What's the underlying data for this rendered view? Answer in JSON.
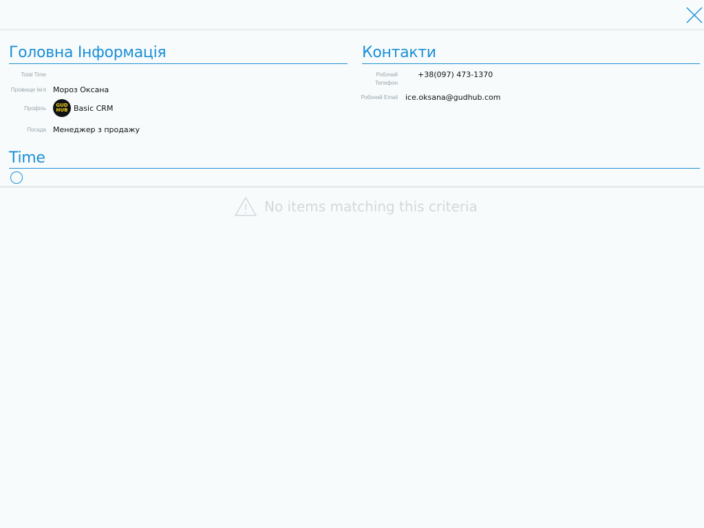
{
  "main_info": {
    "title": "Головна Інформація",
    "fields": [
      {
        "label": "Total Time",
        "value": ""
      },
      {
        "label": "Прізвище Ім'я",
        "value": "Мороз Оксана"
      },
      {
        "label": "Профіль",
        "value": "Basic CRM",
        "avatar_text": "GUD HUB"
      },
      {
        "label": "Посада",
        "value": "Менеджер з продажу"
      }
    ]
  },
  "contacts": {
    "title": "Контакти",
    "phone_label": "Робочий Телефон",
    "phone": "+38(097) 473-1370",
    "email_label": "Робочий Email",
    "email": "ice.oksana@gudhub.com"
  },
  "time_section": {
    "title": "Time",
    "empty_text": "No items matching this criteria"
  },
  "colors": {
    "accent": "#1b8fd6",
    "background": "#f7fbfc",
    "label": "#9aa4aa",
    "empty": "#d3d8db"
  },
  "icons": {
    "close": "close-icon",
    "warning": "warning-icon",
    "circle": "circle-icon"
  }
}
